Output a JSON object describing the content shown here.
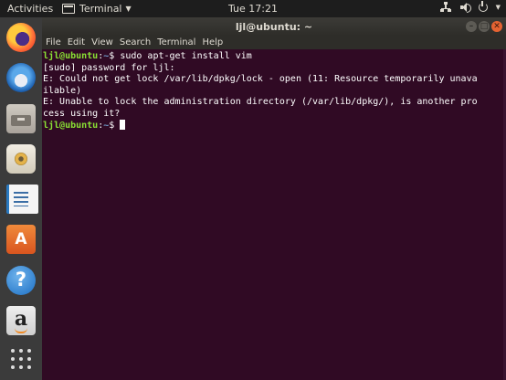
{
  "top_panel": {
    "activities": "Activities",
    "app_menu": "Terminal",
    "clock": "Tue 17:21"
  },
  "dock": {
    "items": [
      "firefox",
      "thunderbird",
      "files",
      "rhythmbox",
      "libreoffice-writer",
      "ubuntu-software",
      "help",
      "amazon",
      "show-applications"
    ]
  },
  "window": {
    "title": "ljl@ubuntu: ~",
    "menu": [
      "File",
      "Edit",
      "View",
      "Search",
      "Terminal",
      "Help"
    ]
  },
  "terminal": {
    "prompt_user": "ljl@ubuntu",
    "prompt_sep": ":",
    "prompt_path": "~",
    "prompt_end": "$ ",
    "command1": "sudo apt-get install vim",
    "line2": "[sudo] password for ljl:",
    "line3": "E: Could not get lock /var/lib/dpkg/lock - open (11: Resource temporarily unava",
    "line4": "ilable)",
    "line5": "E: Unable to lock the administration directory (/var/lib/dpkg/), is another pro",
    "line6": "cess using it?",
    "prompt_end2": "$"
  },
  "colors": {
    "terminal_bg": "#300a24",
    "prompt_user": "#8ae234",
    "prompt_path": "#729fcf",
    "close_button": "#e66332"
  }
}
